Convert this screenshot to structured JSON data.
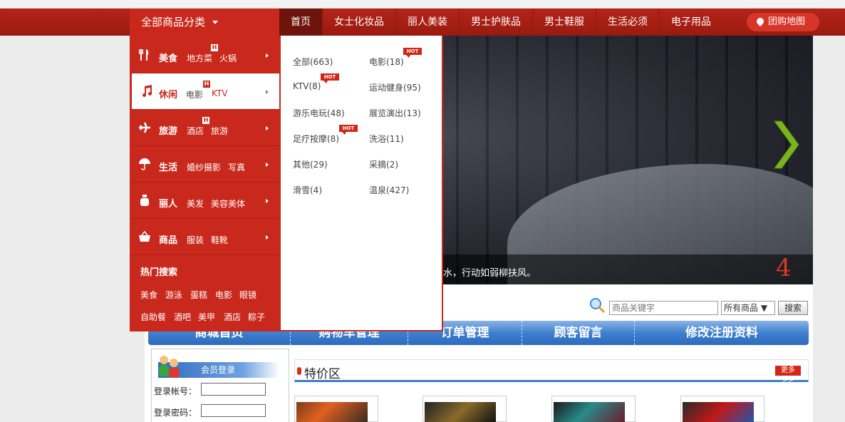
{
  "header": {
    "all_categories": "全部商品分类",
    "nav": [
      "首页",
      "女士化妆品",
      "丽人美装",
      "男士护肤品",
      "男士鞋服",
      "生活必须",
      "电子用品"
    ],
    "map_button": "团购地图"
  },
  "categories": [
    {
      "name": "美食",
      "subs": [
        "地方菜",
        "火锅"
      ],
      "icon": "fork-knife-icon"
    },
    {
      "name": "休闲",
      "subs": [
        "电影",
        "KTV"
      ],
      "icon": "music-note-icon"
    },
    {
      "name": "旅游",
      "subs": [
        "酒店",
        "旅游"
      ],
      "icon": "airplane-icon"
    },
    {
      "name": "生活",
      "subs": [
        "婚纱摄影",
        "写真"
      ],
      "icon": "umbrella-icon"
    },
    {
      "name": "丽人",
      "subs": [
        "美发",
        "美容美体"
      ],
      "icon": "perfume-bottle-icon"
    },
    {
      "name": "商品",
      "subs": [
        "服装",
        "鞋靴"
      ],
      "icon": "basket-icon"
    }
  ],
  "hot_badge": "H",
  "hot_search": {
    "title": "热门搜索",
    "items": [
      "美食",
      "游泳",
      "蛋糕",
      "电影",
      "眼镜",
      "自助餐",
      "酒吧",
      "美甲",
      "酒店",
      "粽子"
    ]
  },
  "subpanel": {
    "items": [
      "全部(663)",
      "电影(18)",
      "KTV(8)",
      "运动健身(95)",
      "游乐电玩(48)",
      "展览演出(13)",
      "足疗按摩(8)",
      "洗浴(11)",
      "其他(29)",
      "采摘(2)",
      "滑雪(4)",
      "温泉(427)"
    ],
    "hot_label": "HOT"
  },
  "banner": {
    "caption": "水，行动如弱柳扶风。",
    "page_number": "4"
  },
  "search": {
    "placeholder": "商品关键字",
    "scope": "所有商品",
    "button": "搜索"
  },
  "blue_nav": [
    "商城首页",
    "购物车管理",
    "订单管理",
    "顾客留言",
    "修改注册资料"
  ],
  "login": {
    "title": "会员登录",
    "account_label": "登录帐号：",
    "password_label": "登录密码："
  },
  "special": {
    "title": "特价区",
    "more": "更多>>"
  }
}
